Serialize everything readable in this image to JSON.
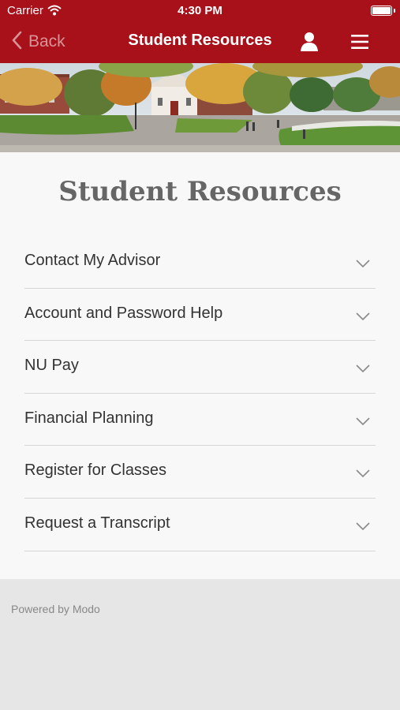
{
  "status_bar": {
    "carrier": "Carrier",
    "time": "4:30 PM"
  },
  "nav": {
    "back_label": "Back",
    "title": "Student Resources"
  },
  "page": {
    "title": "Student Resources"
  },
  "accordion": {
    "items": [
      {
        "label": "Contact My Advisor"
      },
      {
        "label": "Account and Password Help"
      },
      {
        "label": "NU Pay"
      },
      {
        "label": "Financial Planning"
      },
      {
        "label": "Register for Classes"
      },
      {
        "label": "Request a Transcript"
      }
    ]
  },
  "footer": {
    "powered_by": "Powered by Modo"
  },
  "colors": {
    "brand": "#a8101a",
    "content_bg": "#f8f8f8",
    "footer_bg": "#e6e6e6"
  },
  "icons": [
    "wifi-icon",
    "battery-icon",
    "chevron-left-icon",
    "user-icon",
    "menu-icon",
    "chevron-down-icon"
  ]
}
